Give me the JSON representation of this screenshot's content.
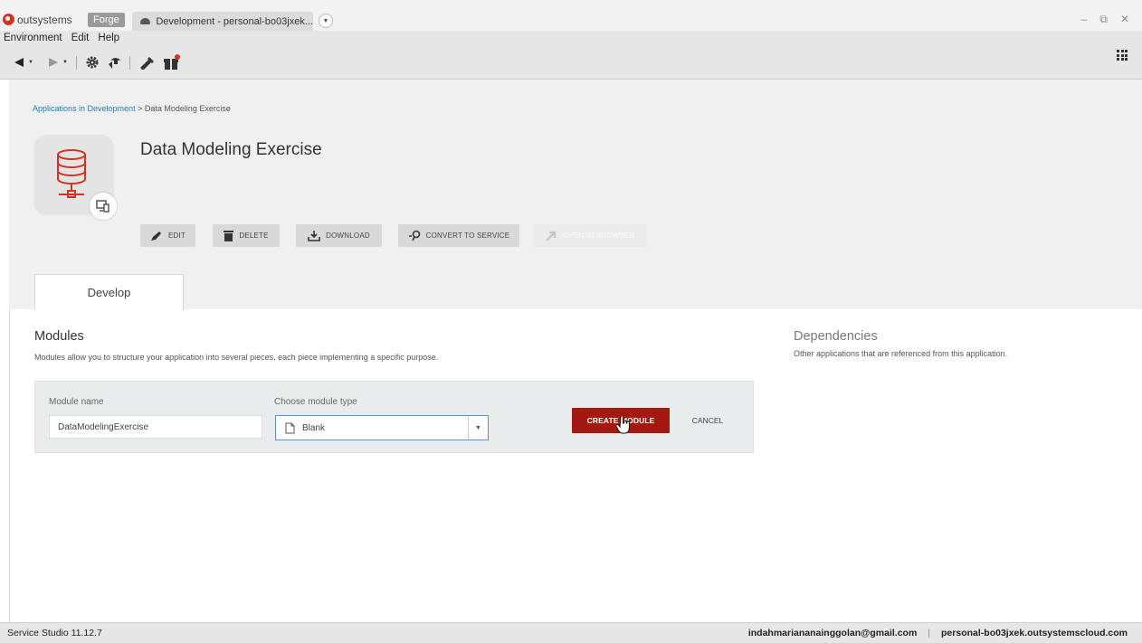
{
  "titlebar": {
    "brand": "outsystems",
    "forge_tab": "Forge",
    "env_tab": "Development - personal-bo03jxek..."
  },
  "menu": {
    "items": [
      "Environment",
      "Edit",
      "Help"
    ]
  },
  "breadcrumb": {
    "link": "Applications in Development",
    "separator": " > ",
    "current": "Data Modeling Exercise"
  },
  "app": {
    "title": "Data Modeling Exercise",
    "actions": {
      "edit": "EDIT",
      "delete": "DELETE",
      "download": "DOWNLOAD",
      "convert": "CONVERT TO SERVICE",
      "open": "OPEN IN BROWSER"
    },
    "tab": "Develop"
  },
  "modules": {
    "title": "Modules",
    "description": "Modules allow you to structure your application into several pieces, each piece implementing a specific purpose.",
    "form": {
      "name_label": "Module name",
      "name_value": "DataModelingExercise",
      "type_label": "Choose module type",
      "type_value": "Blank",
      "create_label": "CREATE MODULE",
      "cancel_label": "CANCEL"
    }
  },
  "dependencies": {
    "title": "Dependencies",
    "description": "Other applications that are referenced from this application."
  },
  "status": {
    "version": "Service Studio 11.12.7",
    "user": "indahmariananainggolan@gmail.com",
    "separator": "|",
    "environment": "personal-bo03jxek.outsystemscloud.com"
  },
  "colors": {
    "accent": "#a3180f",
    "link": "#1b80c4",
    "brand": "#d6331f"
  }
}
